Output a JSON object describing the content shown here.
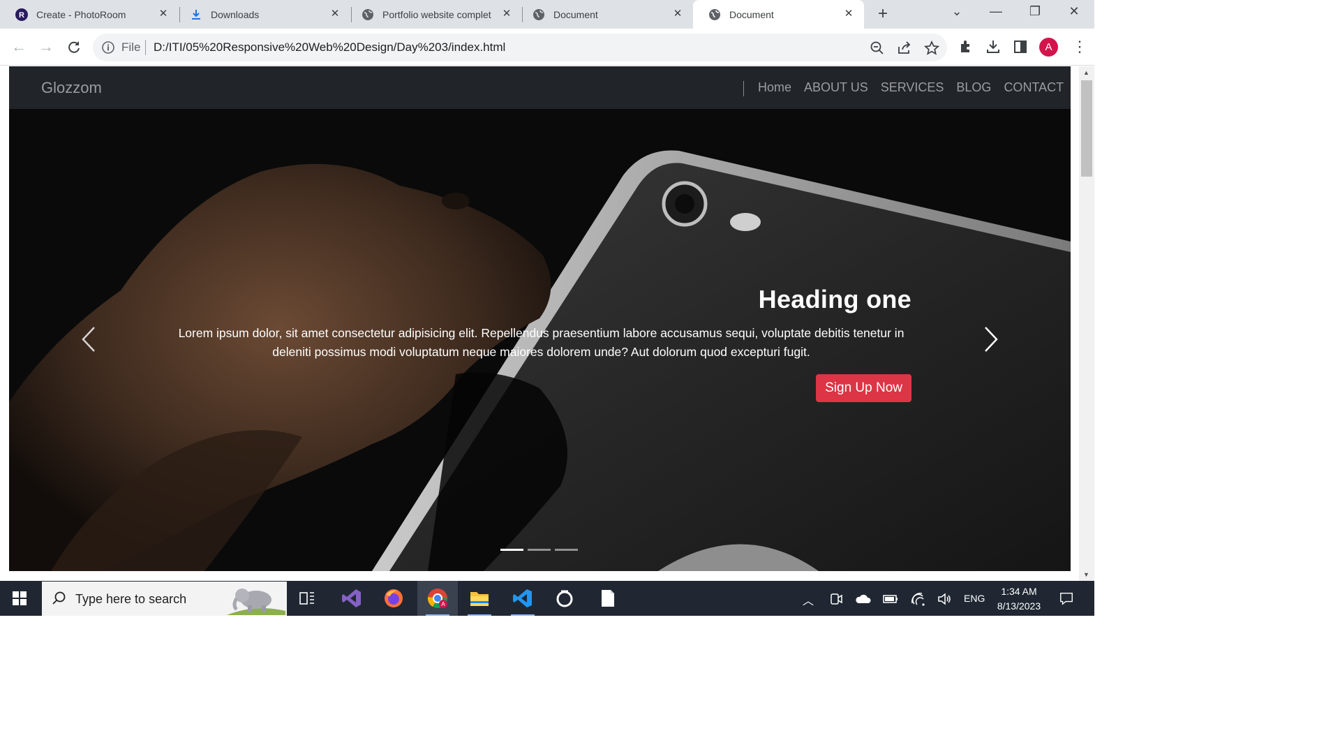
{
  "browser": {
    "tabs": [
      {
        "title": "Create - PhotoRoom",
        "icon": "photoroom-icon",
        "active": false
      },
      {
        "title": "Downloads",
        "icon": "download-icon",
        "active": false
      },
      {
        "title": "Portfolio website complet",
        "icon": "globe-icon",
        "active": false
      },
      {
        "title": "Document",
        "icon": "globe-icon",
        "active": false
      },
      {
        "title": "Document",
        "icon": "globe-icon",
        "active": true
      }
    ],
    "new_tab": "+",
    "address": {
      "scheme": "File",
      "url": "D:/ITI/05%20Responsive%20Web%20Design/Day%203/index.html"
    },
    "profile_initial": "A"
  },
  "site": {
    "brand": "Glozzom",
    "nav": [
      "Home",
      "ABOUT US",
      "SERVICES",
      "BLOG",
      "CONTACT"
    ],
    "carousel": {
      "heading": "Heading one",
      "text": "Lorem ipsum dolor, sit amet consectetur adipisicing elit. Repellendus praesentium labore accusamus sequi, voluptate debitis tenetur in deleniti possimus modi voluptatum neque maiores dolorem unde? Aut dolorum quod excepturi fugit.",
      "button": "Sign Up Now",
      "slides_count": 3,
      "active_slide": 1
    },
    "colors": {
      "navbar": "#212529",
      "cta": "#dc3545"
    }
  },
  "taskbar": {
    "search_placeholder": "Type here to search",
    "apps": [
      "task-view-icon",
      "visual-studio-icon",
      "firefox-icon",
      "chrome-icon",
      "file-explorer-icon",
      "vscode-icon",
      "obs-icon",
      "notepad-icon"
    ],
    "language": "ENG",
    "time": "1:34 AM",
    "date": "8/13/2023"
  }
}
